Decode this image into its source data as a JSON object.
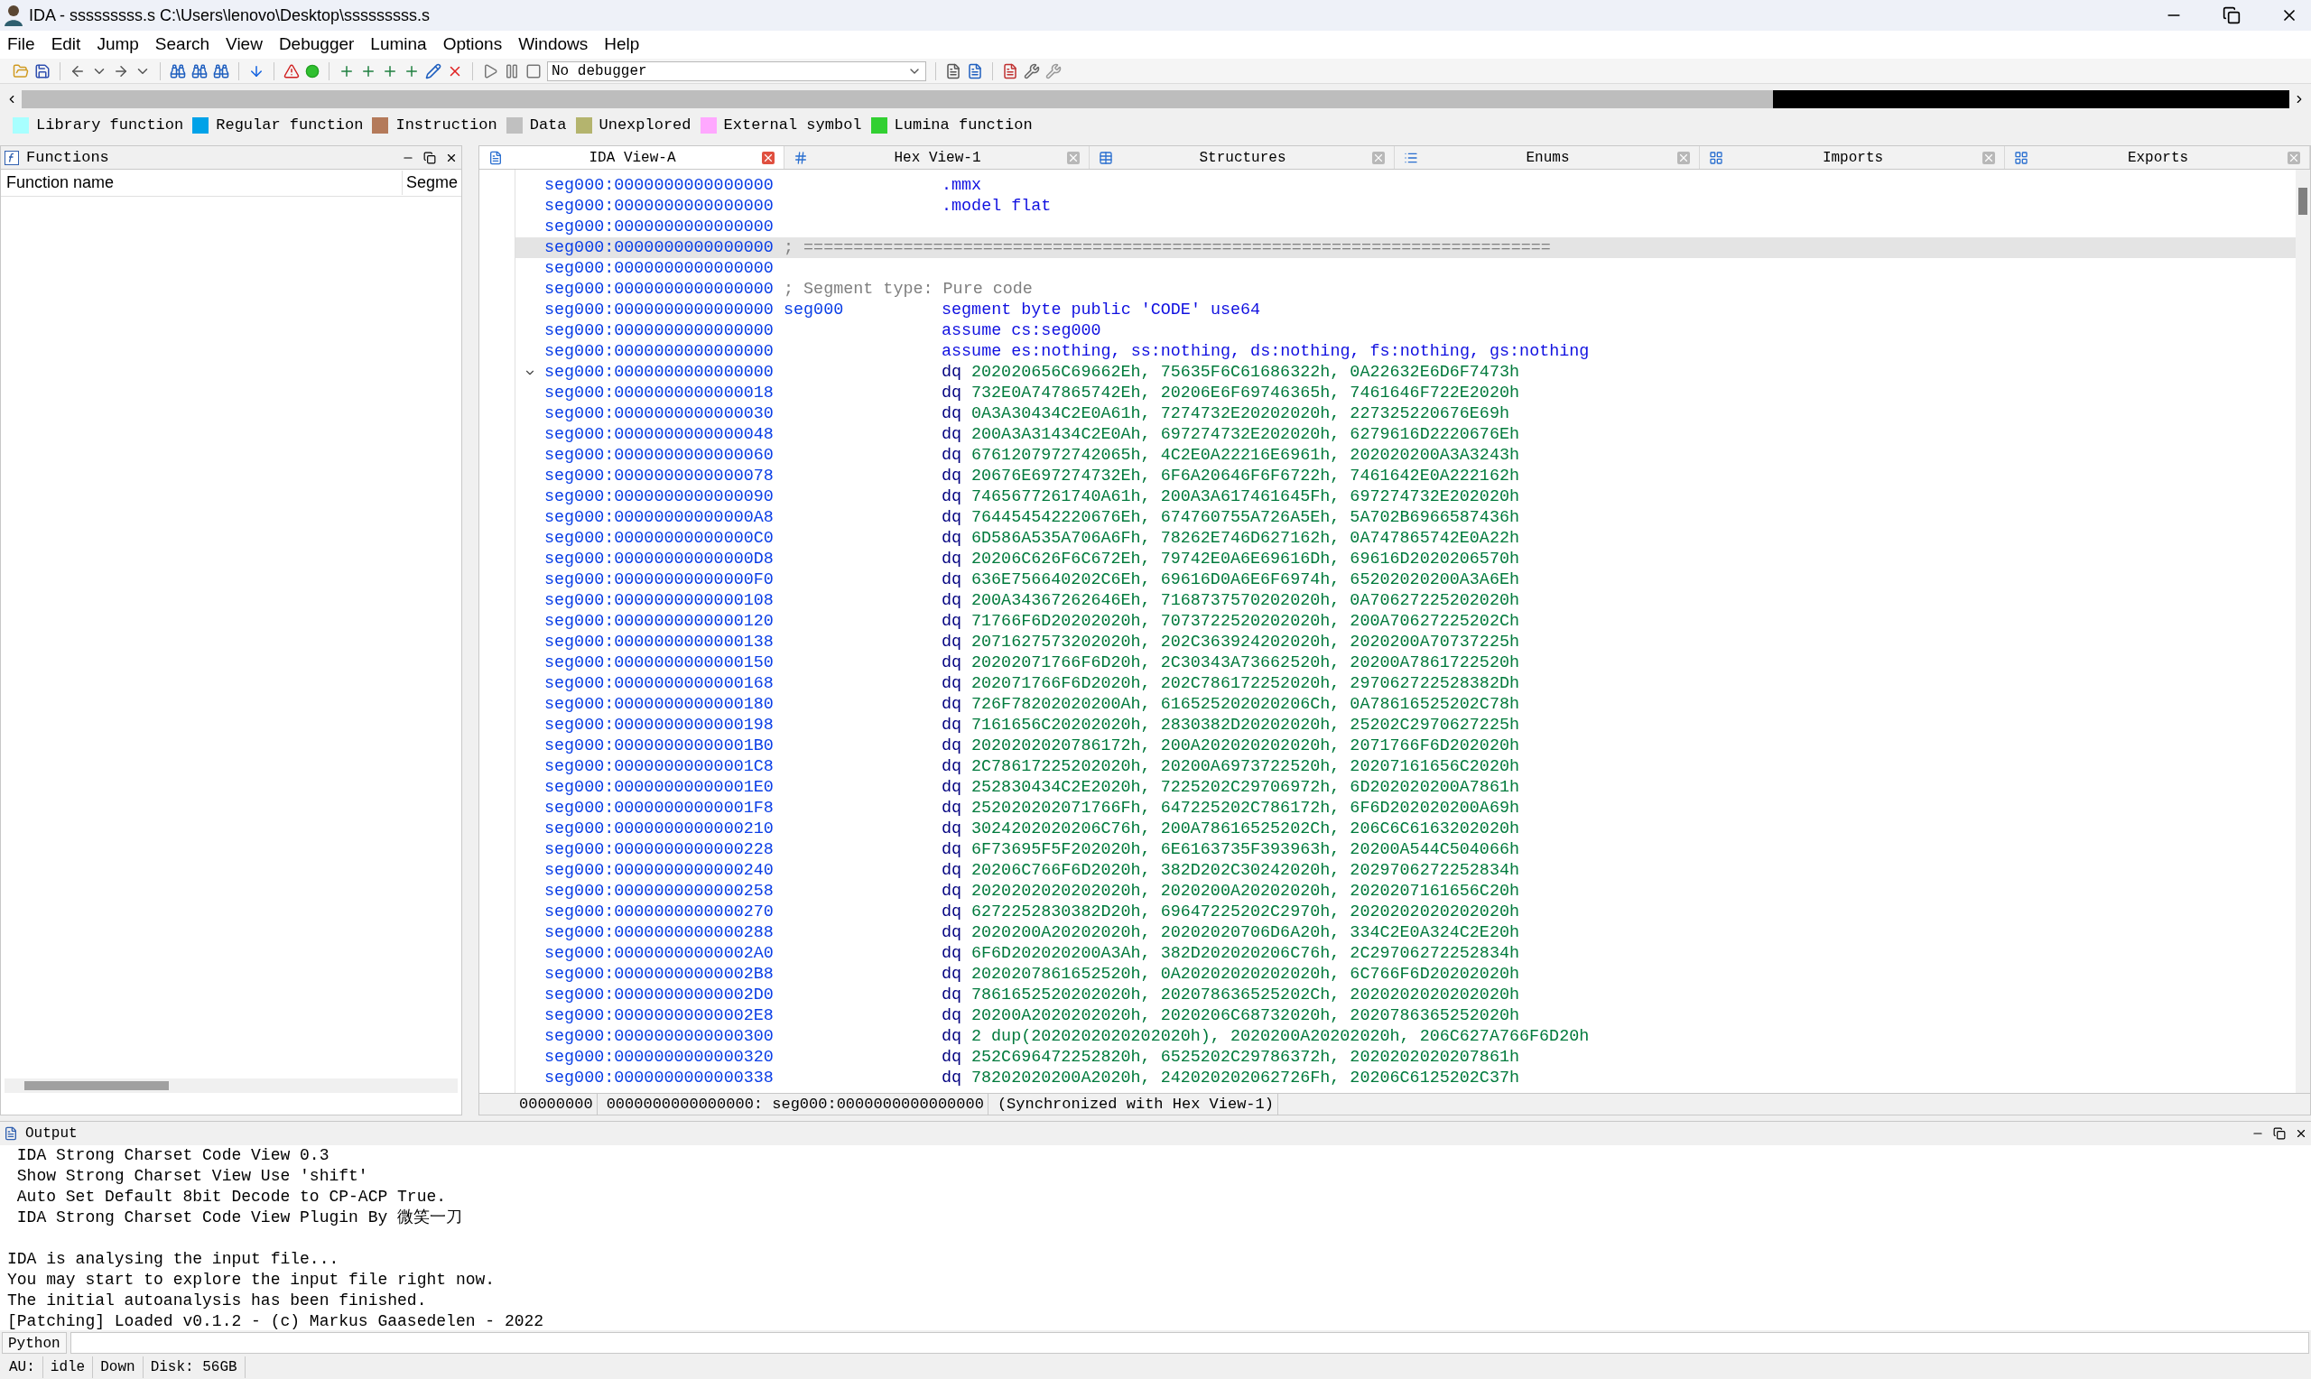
{
  "window": {
    "title": "IDA - sssssssss.s C:\\Users\\lenovo\\Desktop\\sssssssss.s"
  },
  "menu": [
    "File",
    "Edit",
    "Jump",
    "Search",
    "View",
    "Debugger",
    "Lumina",
    "Options",
    "Windows",
    "Help"
  ],
  "toolbar": {
    "debugger_select": "No debugger"
  },
  "legend": [
    {
      "label": "Library function",
      "color": "#a8ffff"
    },
    {
      "label": "Regular function",
      "color": "#00a2e8"
    },
    {
      "label": "Instruction",
      "color": "#b47a5a"
    },
    {
      "label": "Data",
      "color": "#c0c0c0"
    },
    {
      "label": "Unexplored",
      "color": "#b4b46e"
    },
    {
      "label": "External symbol",
      "color": "#ffa8ff"
    },
    {
      "label": "Lumina function",
      "color": "#32d032"
    }
  ],
  "functions_panel": {
    "title": "Functions",
    "columns": [
      "Function name",
      "Segme"
    ]
  },
  "tabs": [
    {
      "label": "IDA View-A",
      "selected": true
    },
    {
      "label": "Hex View-1",
      "selected": false
    },
    {
      "label": "Structures",
      "selected": false
    },
    {
      "label": "Enums",
      "selected": false
    },
    {
      "label": "Imports",
      "selected": false
    },
    {
      "label": "Exports",
      "selected": false
    }
  ],
  "lines": [
    {
      "address": "seg000:0000000000000000",
      "kind": "directive",
      "text": ".mmx",
      "selected": false
    },
    {
      "address": "seg000:0000000000000000",
      "kind": "directive",
      "text": ".model flat",
      "selected": false
    },
    {
      "address": "seg000:0000000000000000",
      "kind": "blank",
      "selected": false
    },
    {
      "address": "seg000:0000000000000000",
      "kind": "comment",
      "text": "; ===========================================================================",
      "selected": true
    },
    {
      "address": "seg000:0000000000000000",
      "kind": "blank",
      "selected": false
    },
    {
      "address": "seg000:0000000000000000",
      "kind": "comment",
      "text": "; Segment type: Pure code",
      "selected": false
    },
    {
      "address": "seg000:0000000000000000",
      "kind": "directive",
      "label": "seg000",
      "text": "segment byte public 'CODE' use64",
      "selected": false
    },
    {
      "address": "seg000:0000000000000000",
      "kind": "directive",
      "text": "assume cs:seg000",
      "selected": false
    },
    {
      "address": "seg000:0000000000000000",
      "kind": "directive",
      "text": "assume es:nothing, ss:nothing, ds:nothing, fs:nothing, gs:nothing",
      "selected": false
    },
    {
      "address": "seg000:0000000000000000",
      "kind": "dq",
      "mnemonic": "dq",
      "text": "202020656C69662Eh, 75635F6C61686322h, 0A22632E6D6F7473h",
      "selected": false
    },
    {
      "address": "seg000:0000000000000018",
      "kind": "dq",
      "mnemonic": "dq",
      "text": "732E0A747865742Eh, 20206E6F69746365h, 7461646F722E2020h",
      "selected": false
    },
    {
      "address": "seg000:0000000000000030",
      "kind": "dq",
      "mnemonic": "dq",
      "text": "0A3A30434C2E0A61h, 7274732E20202020h, 227325220676E69h",
      "selected": false
    },
    {
      "address": "seg000:0000000000000048",
      "kind": "dq",
      "mnemonic": "dq",
      "text": "200A3A31434C2E0Ah, 697274732E202020h, 6279616D2220676Eh",
      "selected": false
    },
    {
      "address": "seg000:0000000000000060",
      "kind": "dq",
      "mnemonic": "dq",
      "text": "6761207972742065h, 4C2E0A22216E6961h, 202020200A3A3243h",
      "selected": false
    },
    {
      "address": "seg000:0000000000000078",
      "kind": "dq",
      "mnemonic": "dq",
      "text": "20676E697274732Eh, 6F6A20646F6F6722h, 7461642E0A222162h",
      "selected": false
    },
    {
      "address": "seg000:0000000000000090",
      "kind": "dq",
      "mnemonic": "dq",
      "text": "7465677261740A61h, 200A3A617461645Fh, 697274732E202020h",
      "selected": false
    },
    {
      "address": "seg000:00000000000000A8",
      "kind": "dq",
      "mnemonic": "dq",
      "text": "764454542220676Eh, 674760755A726A5Eh, 5A702B6966587436h",
      "selected": false
    },
    {
      "address": "seg000:00000000000000C0",
      "kind": "dq",
      "mnemonic": "dq",
      "text": "6D586A535A706A6Fh, 78262E746D627162h, 0A747865742E0A22h",
      "selected": false
    },
    {
      "address": "seg000:00000000000000D8",
      "kind": "dq",
      "mnemonic": "dq",
      "text": "20206C626F6C672Eh, 79742E0A6E69616Dh, 69616D2020206570h",
      "selected": false
    },
    {
      "address": "seg000:00000000000000F0",
      "kind": "dq",
      "mnemonic": "dq",
      "text": "636E756640202C6Eh, 69616D0A6E6F6974h, 65202020200A3A6Eh",
      "selected": false
    },
    {
      "address": "seg000:0000000000000108",
      "kind": "dq",
      "mnemonic": "dq",
      "text": "200A34367262646Eh, 7168737570202020h, 0A70627225202020h",
      "selected": false
    },
    {
      "address": "seg000:0000000000000120",
      "kind": "dq",
      "mnemonic": "dq",
      "text": "71766F6D20202020h, 7073722520202020h, 200A70627225202Ch",
      "selected": false
    },
    {
      "address": "seg000:0000000000000138",
      "kind": "dq",
      "mnemonic": "dq",
      "text": "2071627573202020h, 202C363924202020h, 2020200A70737225h",
      "selected": false
    },
    {
      "address": "seg000:0000000000000150",
      "kind": "dq",
      "mnemonic": "dq",
      "text": "20202071766F6D20h, 2C30343A73662520h, 20200A7861722520h",
      "selected": false
    },
    {
      "address": "seg000:0000000000000168",
      "kind": "dq",
      "mnemonic": "dq",
      "text": "202071766F6D2020h, 202C786172252020h, 297062722528382Dh",
      "selected": false
    },
    {
      "address": "seg000:0000000000000180",
      "kind": "dq",
      "mnemonic": "dq",
      "text": "726F78202020200Ah, 616525202020206Ch, 0A78616525202C78h",
      "selected": false
    },
    {
      "address": "seg000:0000000000000198",
      "kind": "dq",
      "mnemonic": "dq",
      "text": "7161656C20202020h, 2830382D20202020h, 25202C2970627225h",
      "selected": false
    },
    {
      "address": "seg000:00000000000001B0",
      "kind": "dq",
      "mnemonic": "dq",
      "text": "2020202020786172h, 200A202020202020h, 2071766F6D202020h",
      "selected": false
    },
    {
      "address": "seg000:00000000000001C8",
      "kind": "dq",
      "mnemonic": "dq",
      "text": "2C78617225202020h, 20200A6973722520h, 20207161656C2020h",
      "selected": false
    },
    {
      "address": "seg000:00000000000001E0",
      "kind": "dq",
      "mnemonic": "dq",
      "text": "252830434C2E2020h, 7225202C29706972h, 6D202020200A7861h",
      "selected": false
    },
    {
      "address": "seg000:00000000000001F8",
      "kind": "dq",
      "mnemonic": "dq",
      "text": "252020202071766Fh, 647225202C786172h, 6F6D202020200A69h",
      "selected": false
    },
    {
      "address": "seg000:0000000000000210",
      "kind": "dq",
      "mnemonic": "dq",
      "text": "3024202020206C76h, 200A78616525202Ch, 206C6C6163202020h",
      "selected": false
    },
    {
      "address": "seg000:0000000000000228",
      "kind": "dq",
      "mnemonic": "dq",
      "text": "6F73695F5F202020h, 6E6163735F393963h, 20200A544C504066h",
      "selected": false
    },
    {
      "address": "seg000:0000000000000240",
      "kind": "dq",
      "mnemonic": "dq",
      "text": "20206C766F6D2020h, 382D202C30242020h, 2029706272252834h",
      "selected": false
    },
    {
      "address": "seg000:0000000000000258",
      "kind": "dq",
      "mnemonic": "dq",
      "text": "2020202020202020h, 2020200A20202020h, 2020207161656C20h",
      "selected": false
    },
    {
      "address": "seg000:0000000000000270",
      "kind": "dq",
      "mnemonic": "dq",
      "text": "6272252830382D20h, 69647225202C2970h, 2020202020202020h",
      "selected": false
    },
    {
      "address": "seg000:0000000000000288",
      "kind": "dq",
      "mnemonic": "dq",
      "text": "2020200A20202020h, 20202020706D6A20h, 334C2E0A324C2E20h",
      "selected": false
    },
    {
      "address": "seg000:00000000000002A0",
      "kind": "dq",
      "mnemonic": "dq",
      "text": "6F6D202020200A3Ah, 382D202020206C76h, 2C29706272252834h",
      "selected": false
    },
    {
      "address": "seg000:00000000000002B8",
      "kind": "dq",
      "mnemonic": "dq",
      "text": "2020207861652520h, 0A20202020202020h, 6C766F6D20202020h",
      "selected": false
    },
    {
      "address": "seg000:00000000000002D0",
      "kind": "dq",
      "mnemonic": "dq",
      "text": "7861652520202020h, 202078636525202Ch, 2020202020202020h",
      "selected": false
    },
    {
      "address": "seg000:00000000000002E8",
      "kind": "dq",
      "mnemonic": "dq",
      "text": "20200A2020202020h, 2020206C68732020h, 2020786365252020h",
      "selected": false
    },
    {
      "address": "seg000:0000000000000300",
      "kind": "dq",
      "mnemonic": "dq",
      "text": "2 dup(2020202020202020h), 2020200A20202020h, 206C627A766F6D20h",
      "selected": false
    },
    {
      "address": "seg000:0000000000000320",
      "kind": "dq",
      "mnemonic": "dq",
      "text": "252C696472252820h, 6525202C29786372h, 2020202020207861h",
      "selected": false
    },
    {
      "address": "seg000:0000000000000338",
      "kind": "dq",
      "mnemonic": "dq",
      "text": "78202020200A2020h, 242020202062726Fh, 20206C6125202C37h",
      "selected": false
    }
  ],
  "code_status": [
    "00000000",
    "0000000000000000: seg000:0000000000000000",
    "(Synchronized with Hex View-1)"
  ],
  "output": {
    "title": "Output",
    "plugin_lines": [
      " IDA Strong Charset Code View 0.3",
      " Show Strong Charset View Use 'shift'",
      " Auto Set Default 8bit Decode to CP-ACP True.",
      " IDA Strong Charset Code View Plugin By 微笑一刀"
    ],
    "lines": [
      "IDA is analysing the input file...",
      "You may start to explore the input file right now.",
      "The initial autoanalysis has been finished.",
      "[Patching] Loaded v0.1.2 - (c) Markus Gaasedelen - 2022"
    ]
  },
  "python_button": "Python",
  "status_bar": [
    "AU:",
    "idle",
    "Down",
    "Disk: 56GB"
  ]
}
